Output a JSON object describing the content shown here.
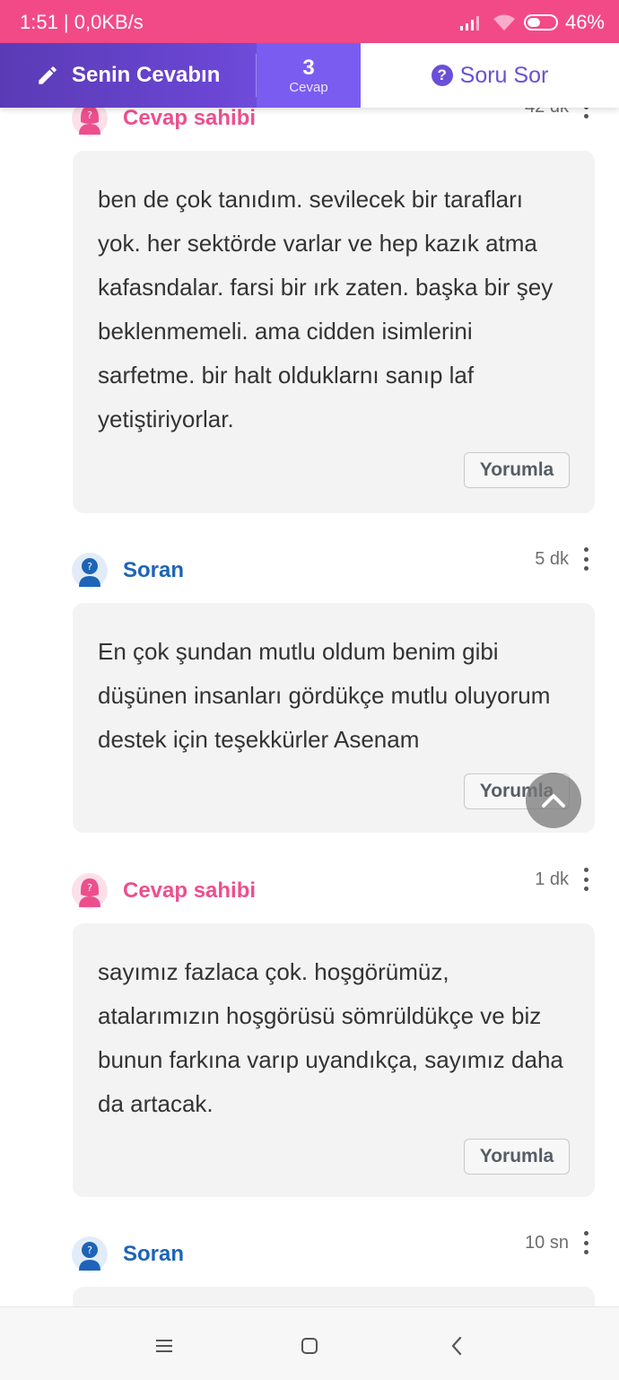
{
  "status": {
    "time": "1:51 | 0,0KB/s",
    "battery": "46%"
  },
  "topbar": {
    "answer_label": "Senin Cevabın",
    "count": "3",
    "count_label": "Cevap",
    "ask_label": "Soru Sor"
  },
  "comments": [
    {
      "author": "Cevap sahibi",
      "role": "owner",
      "time": "42 dk",
      "text": "ben de çok tanıdım. sevilecek bir tarafları yok. her sektörde varlar ve hep kazık atma kafasndalar. farsi bir ırk zaten. başka bir şey beklenmemeli. ama cidden isimlerini sarfetme. bir halt olduklarnı sanıp laf yetiştiriyorlar.",
      "reply_label": "Yorumla"
    },
    {
      "author": "Soran",
      "role": "asker",
      "time": "5 dk",
      "text": "En çok şundan mutlu oldum benim gibi düşünen insanları gördükçe mutlu oluyorum destek için teşekkürler Asenam",
      "reply_label": "Yorumla"
    },
    {
      "author": "Cevap sahibi",
      "role": "owner",
      "time": "1 dk",
      "text": "sayımız fazlaca çok. hoşgörümüz, atalarımızın hoşgörüsü sömrüldükçe ve biz bunun farkına varıp uyandıkça, sayımız daha da artacak.",
      "reply_label": "Yorumla"
    },
    {
      "author": "Soran",
      "role": "asker",
      "time": "10 sn"
    }
  ],
  "colors": {
    "owner": "#ec4f8e",
    "asker": "#1d64b8",
    "accent": "#6b4fd8",
    "status_bar": "#f24a87"
  },
  "icons": [
    "pencil-icon",
    "question-circle-icon",
    "more-vert-icon",
    "chevron-up-icon",
    "menu-icon",
    "home-square-icon",
    "back-icon"
  ]
}
